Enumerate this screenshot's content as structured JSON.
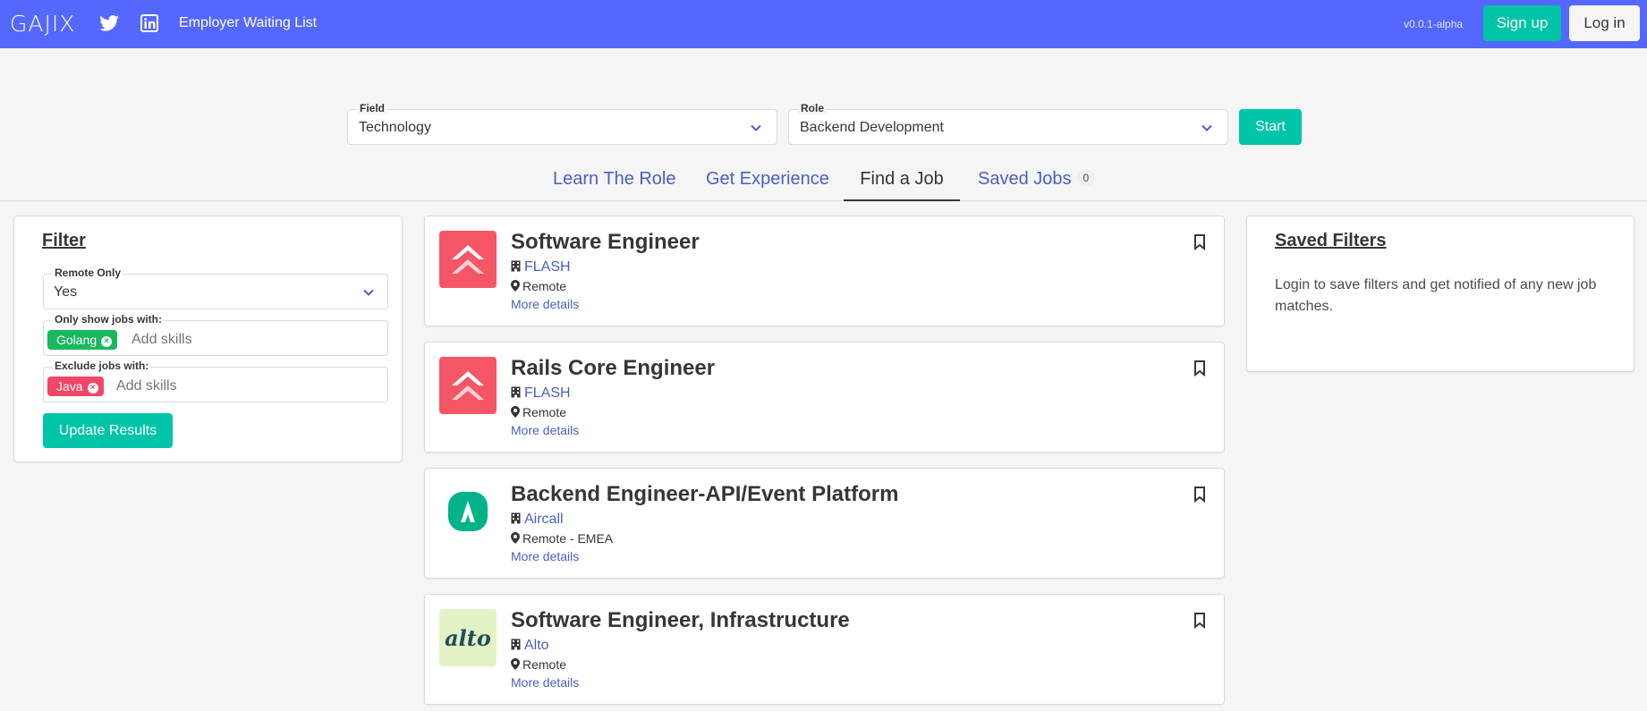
{
  "navbar": {
    "brand": "GAJIX",
    "employer_link": "Employer Waiting List",
    "version": "v0.0.1-alpha",
    "signup_label": "Sign up",
    "login_label": "Log in",
    "color": "#5468ff"
  },
  "search": {
    "field_legend": "Field",
    "field_value": "Technology",
    "role_legend": "Role",
    "role_value": "Backend Development",
    "start_label": "Start"
  },
  "tabs": [
    {
      "label": "Learn The Role"
    },
    {
      "label": "Get Experience"
    },
    {
      "label": "Find a Job",
      "active": true
    },
    {
      "label": "Saved Jobs",
      "count": "0"
    }
  ],
  "filter": {
    "title": "Filter",
    "remote_legend": "Remote Only",
    "remote_value": "Yes",
    "include_legend": "Only show jobs with:",
    "include_tags": [
      "Golang"
    ],
    "include_placeholder": "Add skills",
    "exclude_legend": "Exclude jobs with:",
    "exclude_tags": [
      "Java"
    ],
    "exclude_placeholder": "Add skills",
    "update_label": "Update Results"
  },
  "jobs": [
    {
      "title": "Software Engineer",
      "company": "FLASH",
      "location": "Remote",
      "more": "More details",
      "logo_icon": "flash-logo"
    },
    {
      "title": "Rails Core Engineer",
      "company": "FLASH",
      "location": "Remote",
      "more": "More details",
      "logo_icon": "flash-logo"
    },
    {
      "title": "Backend Engineer-API/Event Platform",
      "company": "Aircall",
      "location": "Remote - EMEA",
      "more": "More details",
      "logo_icon": "aircall-logo"
    },
    {
      "title": "Software Engineer, Infrastructure",
      "company": "Alto",
      "location": "Remote",
      "more": "More details",
      "logo_icon": "alto-logo",
      "logo_text": "alto"
    }
  ],
  "saved_filters": {
    "title": "Saved Filters",
    "text": "Login to save filters and get notified of any new job matches."
  },
  "colors": {
    "primary": "#00c4a7",
    "link": "#485fc7",
    "include_tag": "#18b85f",
    "exclude_tag": "#f14668"
  }
}
